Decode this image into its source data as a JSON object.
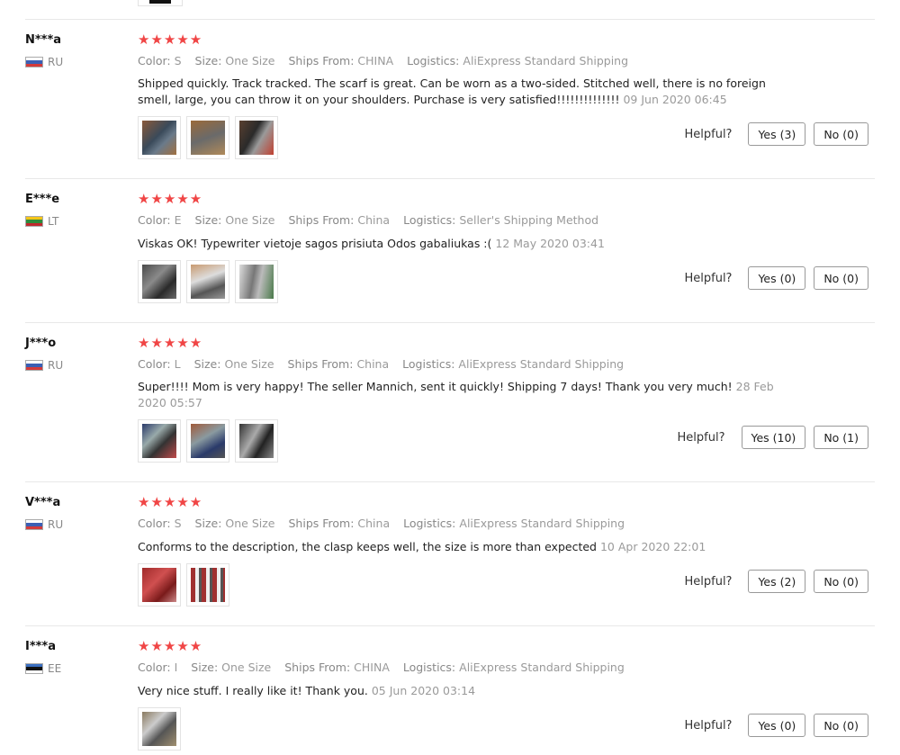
{
  "labels": {
    "color": "Color:",
    "size": "Size:",
    "ships_from": "Ships From:",
    "logistics": "Logistics:",
    "helpful": "Helpful?"
  },
  "star_color": "#f04545",
  "reviews": [
    {
      "user": "N***a",
      "country": "RU",
      "flag": "russia-flag-icon",
      "rating": 5,
      "color": "S",
      "size": "One Size",
      "ships_from": "CHINA",
      "logistics": "AliExpress Standard Shipping",
      "text": "Shipped quickly. Track tracked. The scarf is great. Can be worn as a two-sided. Stitched well, there is no foreign smell, large, you can throw it on your shoulders. Purchase is very satisfied!!!!!!!!!!!!!!",
      "date": "09 Jun 2020 06:45",
      "photos": 3,
      "yes": "Yes (3)",
      "no": "No (0)"
    },
    {
      "user": "E***e",
      "country": "LT",
      "flag": "lithuania-flag-icon",
      "rating": 5,
      "color": "E",
      "size": "One Size",
      "ships_from": "China",
      "logistics": "Seller's Shipping Method",
      "text": "Viskas OK! Typewriter vietoje sagos prisiuta Odos gabaliukas :(",
      "date": "12 May 2020 03:41",
      "photos": 3,
      "yes": "Yes (0)",
      "no": "No (0)"
    },
    {
      "user": "J***o",
      "country": "RU",
      "flag": "russia-flag-icon",
      "rating": 5,
      "color": "L",
      "size": "One Size",
      "ships_from": "China",
      "logistics": "AliExpress Standard Shipping",
      "text": "Super!!!! Mom is very happy! The seller Mannich, sent it quickly! Shipping 7 days! Thank you very much!",
      "date": "28 Feb 2020 05:57",
      "photos": 3,
      "yes": "Yes (10)",
      "no": "No (1)"
    },
    {
      "user": "V***a",
      "country": "RU",
      "flag": "russia-flag-icon",
      "rating": 5,
      "color": "S",
      "size": "One Size",
      "ships_from": "China",
      "logistics": "AliExpress Standard Shipping",
      "text": "Conforms to the description, the clasp keeps well, the size is more than expected",
      "date": "10 Apr 2020 22:01",
      "photos": 2,
      "yes": "Yes (2)",
      "no": "No (0)"
    },
    {
      "user": "I***a",
      "country": "EE",
      "flag": "estonia-flag-icon",
      "rating": 5,
      "color": "I",
      "size": "One Size",
      "ships_from": "CHINA",
      "logistics": "AliExpress Standard Shipping",
      "text": "Very nice stuff. I really like it! Thank you.",
      "date": "05 Jun 2020 03:14",
      "photos": 1,
      "yes": "Yes (0)",
      "no": "No (0)"
    }
  ]
}
